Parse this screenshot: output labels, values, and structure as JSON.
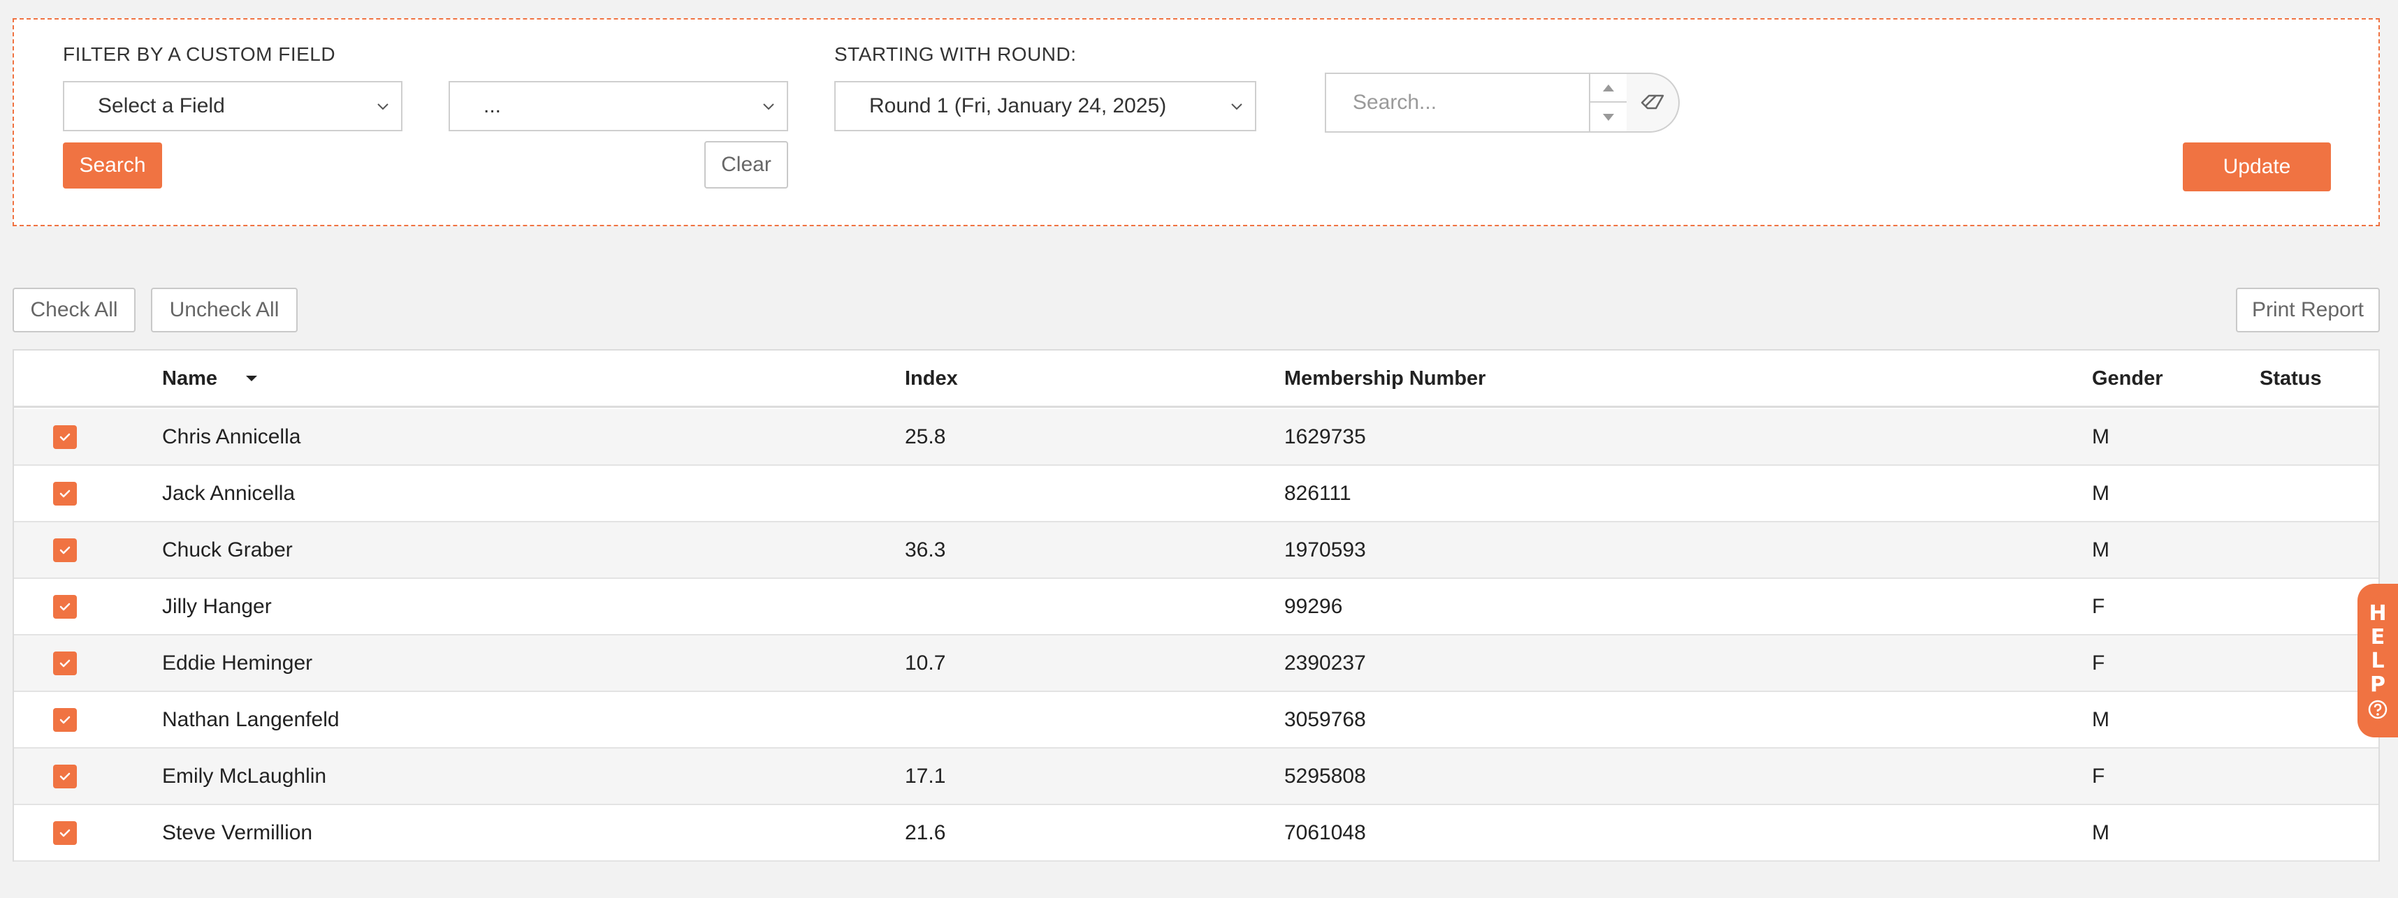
{
  "filter": {
    "custom_field_label": "FILTER BY A CUSTOM FIELD",
    "field_select_value": "Select a Field",
    "value_select_value": "...",
    "round_label": "STARTING WITH ROUND:",
    "round_select_value": "Round 1 (Fri, January 24, 2025)",
    "search_button": "Search",
    "clear_button": "Clear",
    "search_placeholder": "Search...",
    "update_button": "Update"
  },
  "toolbar": {
    "check_all": "Check All",
    "uncheck_all": "Uncheck All",
    "print_report": "Print Report"
  },
  "table": {
    "headers": {
      "name": "Name",
      "index": "Index",
      "membership": "Membership Number",
      "gender": "Gender",
      "status": "Status"
    },
    "rows": [
      {
        "name": "Chris Annicella",
        "index": "25.8",
        "membership": "1629735",
        "gender": "M",
        "status": "",
        "checked": true
      },
      {
        "name": "Jack Annicella",
        "index": "",
        "membership": "826111",
        "gender": "M",
        "status": "",
        "checked": true
      },
      {
        "name": "Chuck Graber",
        "index": "36.3",
        "membership": "1970593",
        "gender": "M",
        "status": "",
        "checked": true
      },
      {
        "name": "Jilly Hanger",
        "index": "",
        "membership": "99296",
        "gender": "F",
        "status": "",
        "checked": true
      },
      {
        "name": "Eddie Heminger",
        "index": "10.7",
        "membership": "2390237",
        "gender": "F",
        "status": "",
        "checked": true
      },
      {
        "name": "Nathan Langenfeld",
        "index": "",
        "membership": "3059768",
        "gender": "M",
        "status": "",
        "checked": true
      },
      {
        "name": "Emily McLaughlin",
        "index": "17.1",
        "membership": "5295808",
        "gender": "F",
        "status": "",
        "checked": true
      },
      {
        "name": "Steve Vermillion",
        "index": "21.6",
        "membership": "7061048",
        "gender": "M",
        "status": "",
        "checked": true
      }
    ]
  },
  "help": {
    "letters": [
      "H",
      "E",
      "L",
      "P"
    ],
    "icon": "question-circle-icon"
  },
  "colors": {
    "accent": "#f07342",
    "background": "#f2f2f2"
  }
}
